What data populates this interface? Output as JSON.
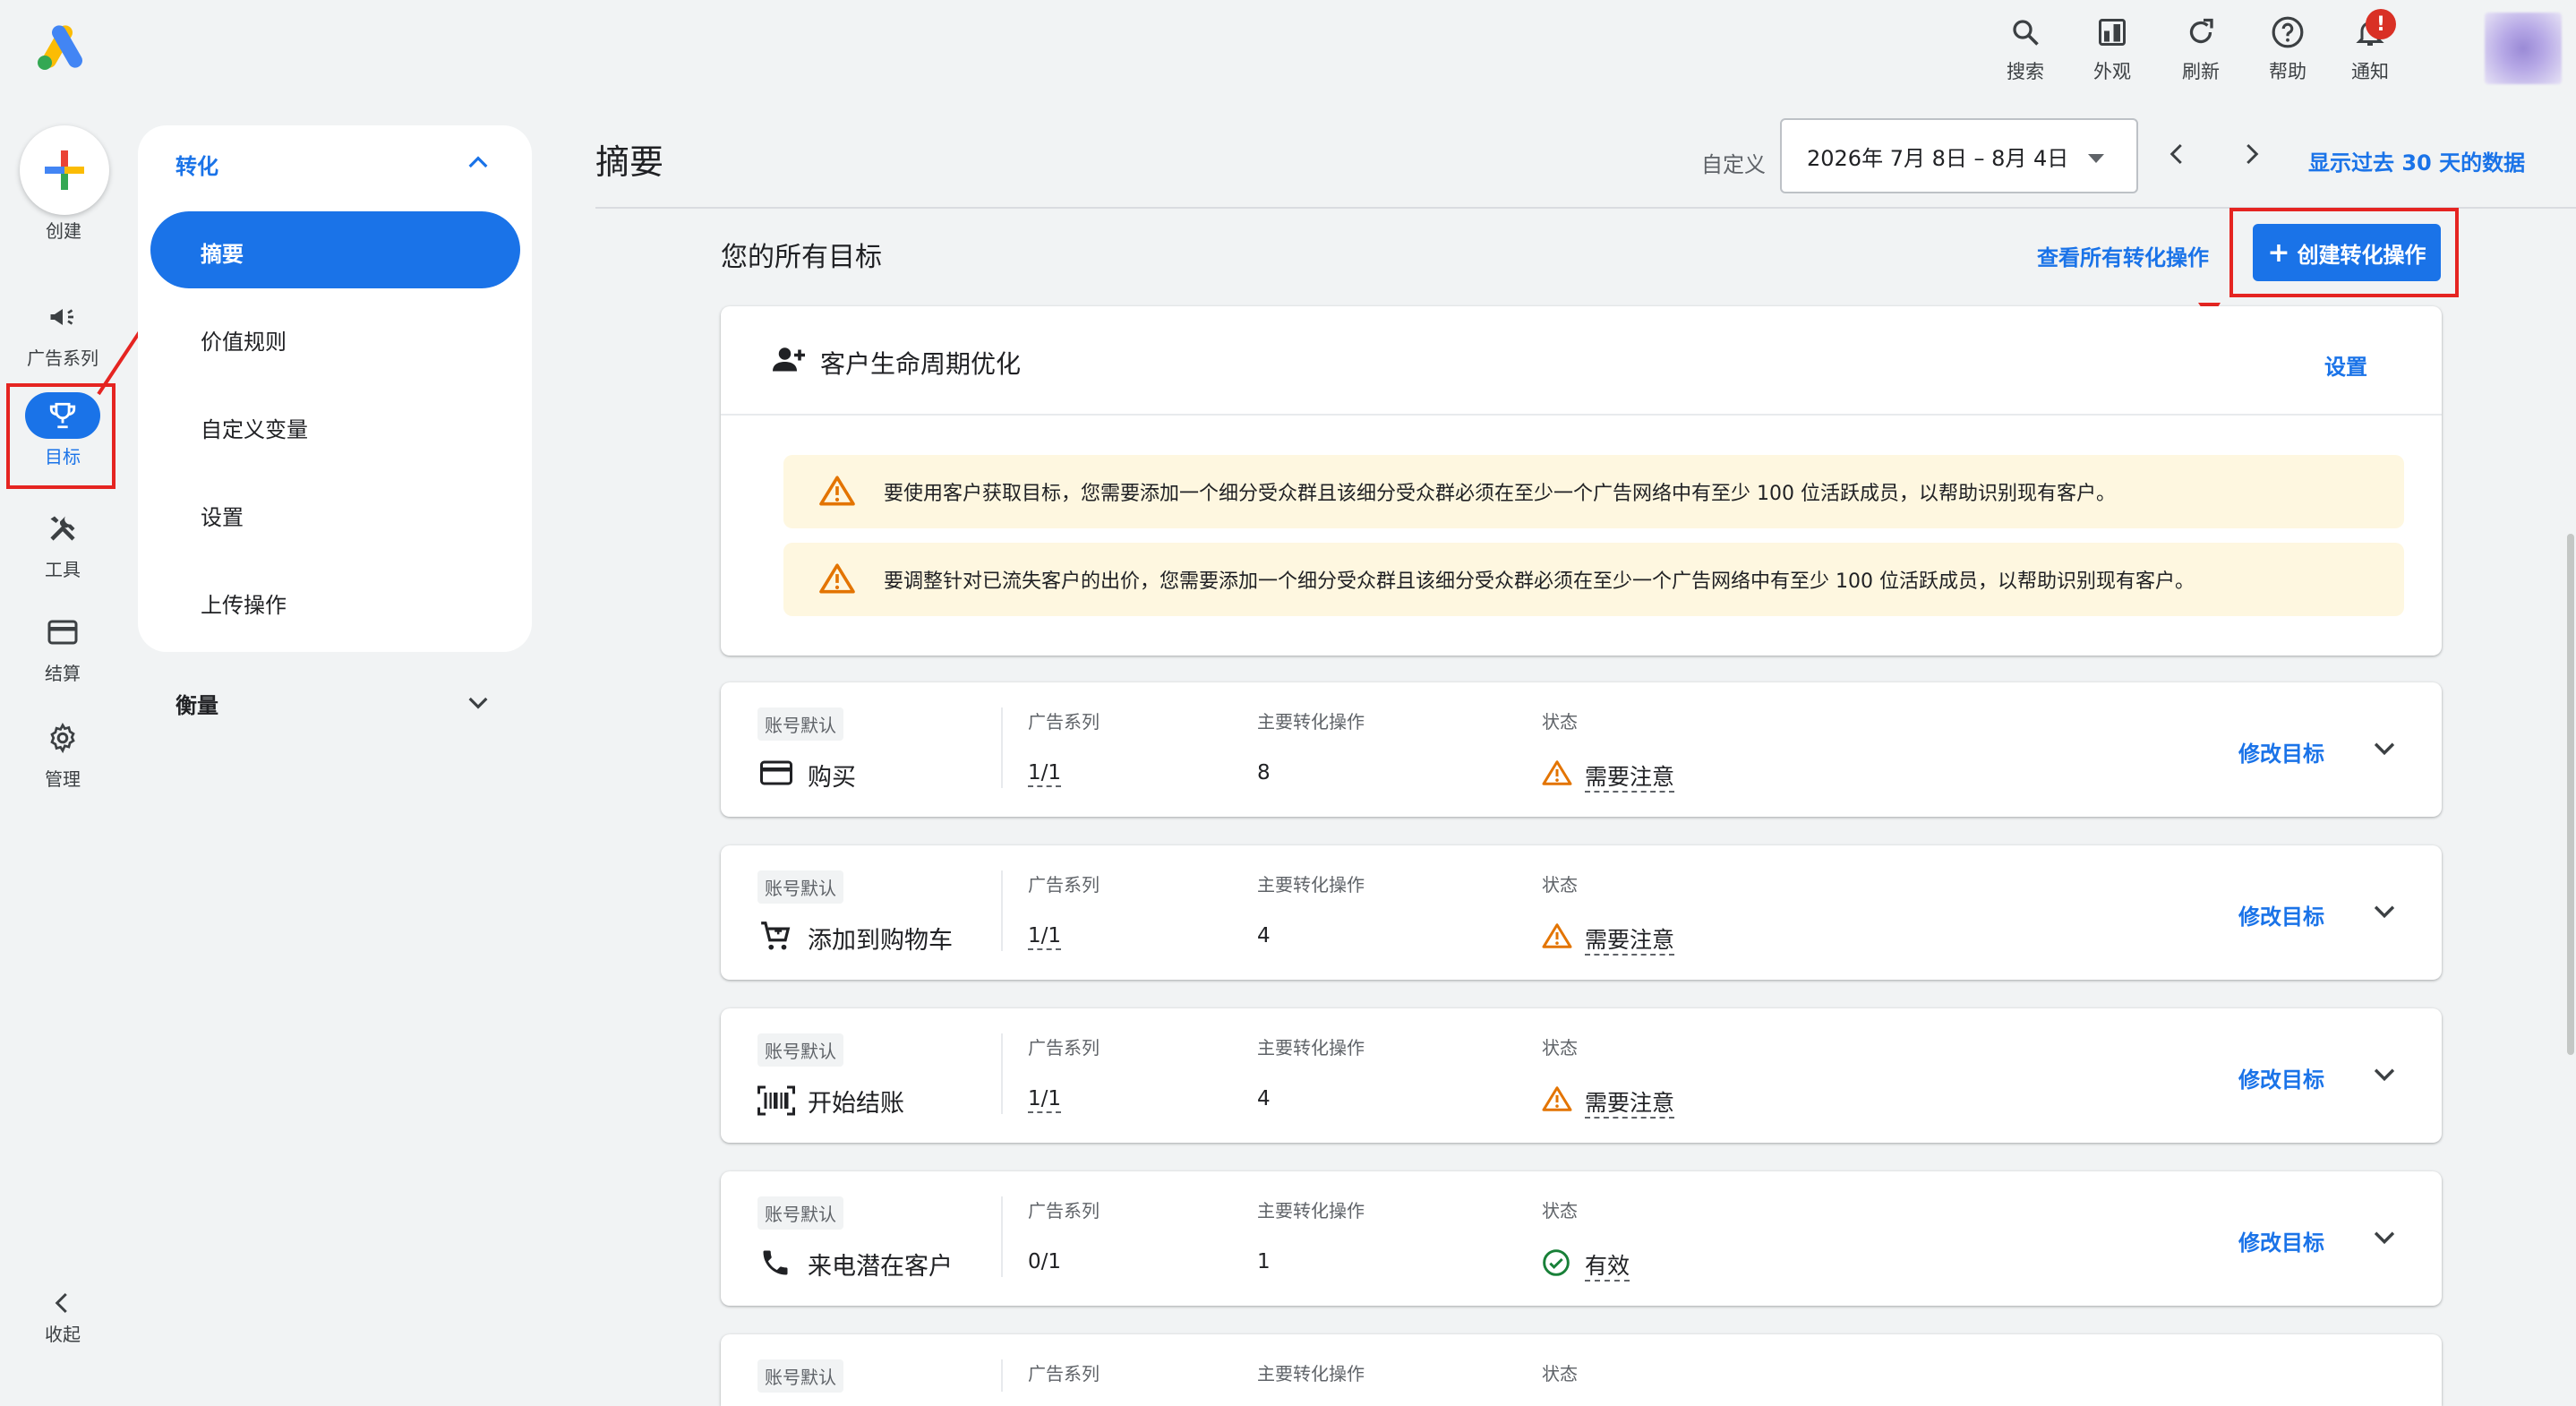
{
  "colors": {
    "accent": "#1a73e8",
    "warning": "#e37400",
    "success": "#188038",
    "badge": "#d93025",
    "annotation": "#e52421"
  },
  "topbar": {
    "buttons": [
      {
        "label": "搜索",
        "icon": "search-icon"
      },
      {
        "label": "外观",
        "icon": "appearance-icon"
      },
      {
        "label": "刷新",
        "icon": "refresh-icon"
      },
      {
        "label": "帮助",
        "icon": "help-icon"
      },
      {
        "label": "通知",
        "icon": "bell-icon"
      }
    ],
    "notification_badge": "!"
  },
  "rail": {
    "create_label": "创建",
    "items": [
      {
        "label": "广告系列",
        "icon": "megaphone-icon"
      },
      {
        "label": "目标",
        "icon": "trophy-icon",
        "active": true
      },
      {
        "label": "工具",
        "icon": "tools-icon"
      },
      {
        "label": "结算",
        "icon": "credit-card-icon"
      },
      {
        "label": "管理",
        "icon": "gear-icon"
      }
    ],
    "collapse_label": "收起"
  },
  "nav": {
    "section": "转化",
    "items": [
      "摘要",
      "价值规则",
      "自定义变量",
      "设置",
      "上传操作"
    ],
    "active_item": "摘要",
    "section2": "衡量"
  },
  "header": {
    "title": "摘要",
    "date_label": "自定义",
    "date_range": "2026年 7月 8日 – 8月 4日",
    "last30": "显示过去 30 天的数据"
  },
  "goals": {
    "title": "您的所有目标",
    "view_all": "查看所有转化操作",
    "create_label": "创建转化操作",
    "lifecycle": {
      "title": "客户生命周期优化",
      "settings": "设置",
      "warnings": [
        "要使用客户获取目标，您需要添加一个细分受众群且该细分受众群必须在至少一个广告网络中有至少 100 位活跃成员，以帮助识别现有客户。",
        "要调整针对已流失客户的出价，您需要添加一个细分受众群且该细分受众群必须在至少一个广告网络中有至少 100 位活跃成员，以帮助识别现有客户。"
      ]
    },
    "columns": {
      "campaigns": "广告系列",
      "primary_actions": "主要转化操作",
      "status": "状态"
    },
    "tag": "账号默认",
    "edit_label": "修改目标",
    "rows": [
      {
        "name": "购买",
        "icon": "credit-card-icon",
        "campaigns": "1/1",
        "actions": "8",
        "status": "需要注意",
        "status_type": "warning"
      },
      {
        "name": "添加到购物车",
        "icon": "cart-icon",
        "campaigns": "1/1",
        "actions": "4",
        "status": "需要注意",
        "status_type": "warning"
      },
      {
        "name": "开始结账",
        "icon": "barcode-icon",
        "campaigns": "1/1",
        "actions": "4",
        "status": "需要注意",
        "status_type": "warning"
      },
      {
        "name": "来电潜在客户",
        "icon": "phone-icon",
        "campaigns": "0/1",
        "actions": "1",
        "status": "有效",
        "status_type": "ok"
      }
    ],
    "partial_row": {
      "tag": "账号默认"
    }
  }
}
